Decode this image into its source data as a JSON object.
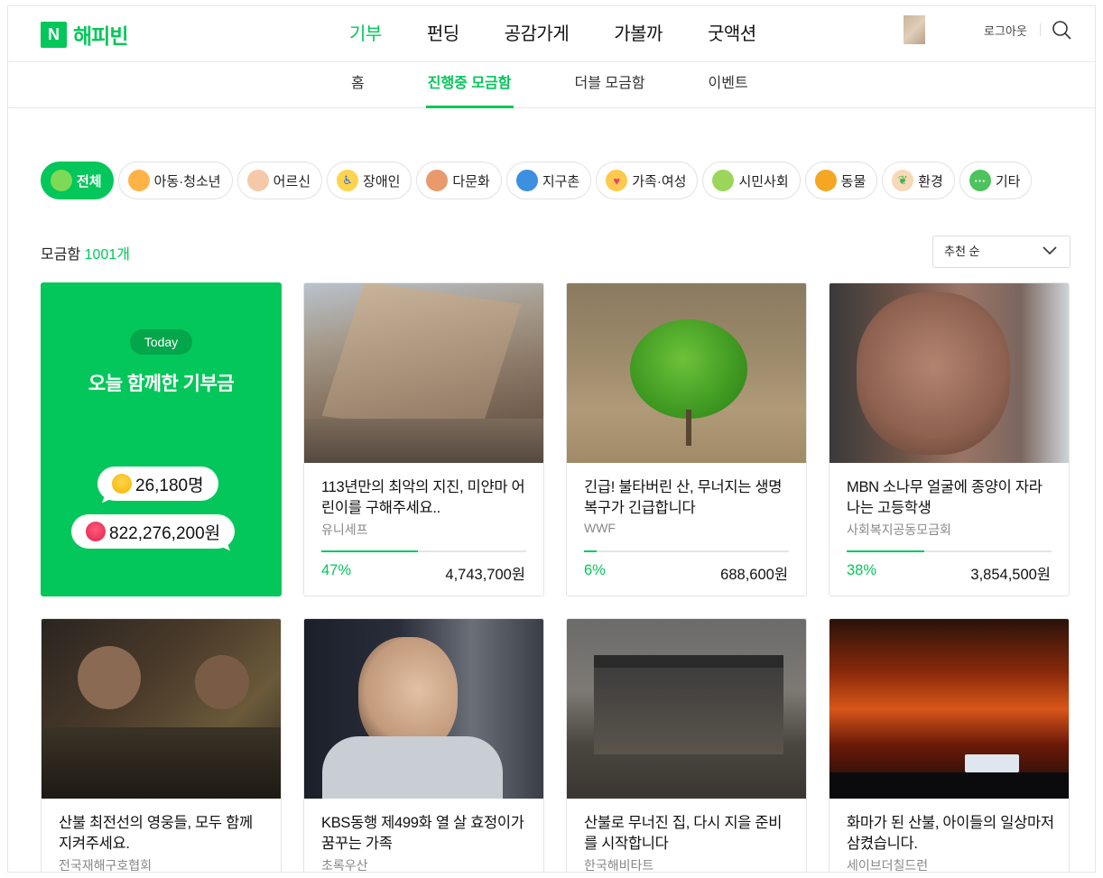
{
  "header": {
    "logo_mark": "N",
    "logo_text": "해피빈",
    "nav": [
      "기부",
      "펀딩",
      "공감가게",
      "가볼까",
      "굿액션"
    ],
    "active_nav": "기부",
    "logout": "로그아웃"
  },
  "subnav": {
    "items": [
      "홈",
      "진행중 모금함",
      "더블 모금함",
      "이벤트"
    ],
    "active": "진행중 모금함"
  },
  "categories": [
    {
      "label": "전체",
      "icon": "leaf-icon",
      "active": true
    },
    {
      "label": "아동·청소년",
      "icon": "child-icon"
    },
    {
      "label": "어르신",
      "icon": "elder-icon"
    },
    {
      "label": "장애인",
      "icon": "wheelchair-icon"
    },
    {
      "label": "다문화",
      "icon": "handshake-icon"
    },
    {
      "label": "지구촌",
      "icon": "globe-icon"
    },
    {
      "label": "가족·여성",
      "icon": "house-heart-icon"
    },
    {
      "label": "시민사회",
      "icon": "people-icon"
    },
    {
      "label": "동물",
      "icon": "animal-icon"
    },
    {
      "label": "환경",
      "icon": "sprout-icon"
    },
    {
      "label": "기타",
      "icon": "more-icon"
    }
  ],
  "listing": {
    "count_label": "모금함",
    "count_value": "1001개",
    "sort_label": "추천 순"
  },
  "today": {
    "badge": "Today",
    "title": "오늘 함께한 기부금",
    "people": "26,180명",
    "amount": "822,276,200원"
  },
  "cards": [
    {
      "title": "113년만의 최악의 지진, 미얀마 어린이를 구해주세요..",
      "org": "유니세프",
      "percent_label": "47%",
      "progress": 0.47,
      "amount": "4,743,700원"
    },
    {
      "title": "긴급! 불타버린 산, 무너지는 생명 복구가 긴급합니다",
      "org": "WWF",
      "percent_label": "6%",
      "progress": 0.06,
      "amount": "688,600원"
    },
    {
      "title": "MBN 소나무 얼굴에 종양이 자라나는 고등학생",
      "org": "사회복지공동모금회",
      "percent_label": "38%",
      "progress": 0.38,
      "amount": "3,854,500원"
    },
    {
      "title": "산불 최전선의 영웅들, 모두 함께 지켜주세요.",
      "org": "전국재해구호협회"
    },
    {
      "title": "KBS동행 제499화 열 살 효정이가 꿈꾸는 가족",
      "org": "초록우산"
    },
    {
      "title": "산불로 무너진 집, 다시 지을 준비를 시작합니다",
      "org": "한국해비타트"
    },
    {
      "title": "화마가 된 산불, 아이들의 일상마저 삼켰습니다.",
      "org": "세이브더칠드런"
    }
  ],
  "colors": {
    "accent": "#03c75a",
    "accent_dark": "#03a64b"
  }
}
